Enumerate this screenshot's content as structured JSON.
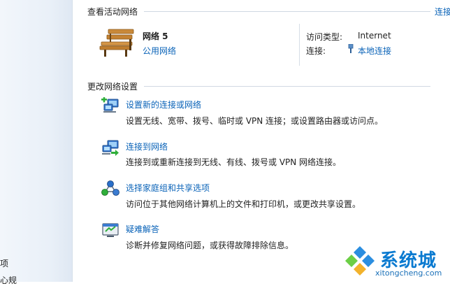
{
  "sidebar": {
    "items": [
      {
        "label": "项"
      },
      {
        "label": "心规"
      }
    ]
  },
  "active_networks": {
    "section_title": "查看活动网络",
    "right_link": "连接",
    "network_name": "网络 5",
    "network_category": "公用网络",
    "access_type_label": "访问类型:",
    "access_type_value": "Internet",
    "connections_label": "连接:",
    "connection_value": "本地连接"
  },
  "change_settings": {
    "section_title": "更改网络设置",
    "tasks": [
      {
        "title": "设置新的连接或网络",
        "description": "设置无线、宽带、拨号、临时或 VPN 连接；或设置路由器或访问点。",
        "icon": "new-connection-icon"
      },
      {
        "title": "连接到网络",
        "description": "连接到或重新连接到无线、有线、拨号或 VPN 网络连接。",
        "icon": "connect-network-icon"
      },
      {
        "title": "选择家庭组和共享选项",
        "description": "访问位于其他网络计算机上的文件和打印机，或更改共享设置。",
        "icon": "homegroup-icon"
      },
      {
        "title": "疑难解答",
        "description": "诊断并修复网络问题，或获得故障排除信息。",
        "icon": "troubleshoot-icon"
      }
    ]
  },
  "watermark": {
    "brand": "系统城",
    "url": "xitongcheng.com"
  },
  "colors": {
    "link": "#0a63b8",
    "text": "#1e1e1e",
    "rule": "#d0d8e2",
    "sidebar_bg": "#e9f0f8"
  }
}
